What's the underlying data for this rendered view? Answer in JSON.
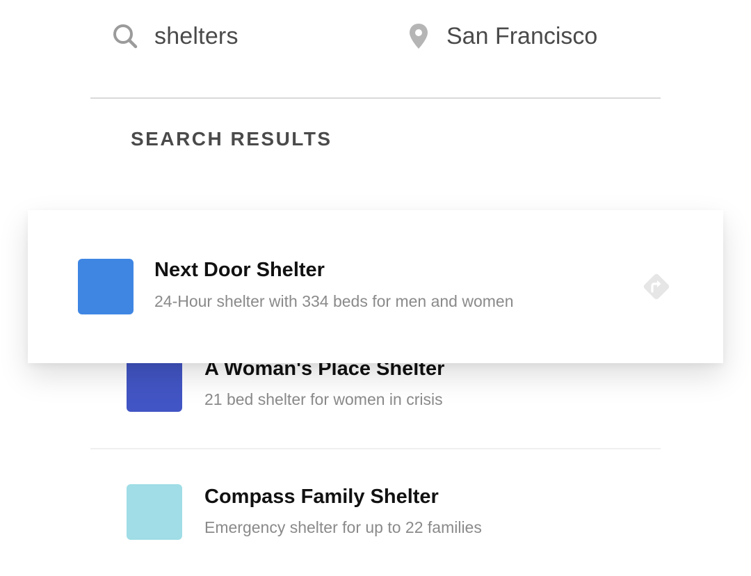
{
  "search": {
    "query": "shelters",
    "location": "San Francisco",
    "search_icon": "search-icon",
    "location_icon": "map-pin-icon"
  },
  "results": {
    "heading": "SEARCH RESULTS",
    "featured": {
      "name": "Next Door Shelter",
      "description": "24-Hour shelter with 334 beds for men and women",
      "color": "#3f86e3",
      "action_icon": "directions-icon"
    },
    "items": [
      {
        "name": "A Woman's Place Shelter",
        "description": "21 bed shelter for women in crisis",
        "color": "#4255c4"
      },
      {
        "name": "Compass Family Shelter",
        "description": "Emergency shelter for up to 22 families",
        "color": "#a0dde6"
      }
    ]
  },
  "colors": {
    "text_primary": "#111111",
    "text_secondary": "#8a8a8a",
    "icon_gray": "#9b9b9b"
  }
}
